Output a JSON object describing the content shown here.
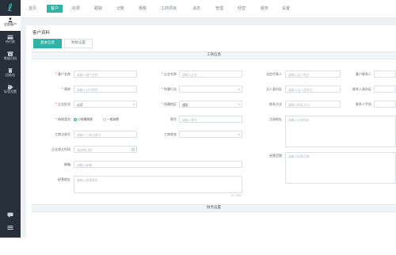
{
  "sidebar": {
    "items": [
      {
        "label": "全部客户",
        "icon": "user-icon"
      },
      {
        "label": "待付款",
        "icon": "card-icon"
      },
      {
        "label": "数据归档",
        "icon": "archive-icon"
      },
      {
        "label": "回收站",
        "icon": "trash-icon"
      },
      {
        "label": "标签设置",
        "icon": "tag-icon"
      }
    ]
  },
  "topnav": {
    "tabs": [
      "首页",
      "客户",
      "收费",
      "跟踪",
      "记账",
      "报税",
      "工商项目",
      "消息",
      "管理",
      "经营",
      "服务",
      "设置"
    ],
    "active_index": 1
  },
  "page": {
    "title": "客户资料",
    "tabs": [
      "基本信息",
      "财税设置"
    ],
    "active_tab": 0,
    "section_business": "工商信息",
    "section_finance": "财务设置"
  },
  "form": {
    "customer_name": {
      "label": "客户名称",
      "placeholder": "请输入客户名称"
    },
    "company_name": {
      "label": "企业名称",
      "placeholder": "请输入企业"
    },
    "short_name": {
      "label": "简称",
      "placeholder": "请输入公司简称"
    },
    "industry": {
      "label": "所属行业",
      "placeholder": ""
    },
    "company_form": {
      "label": "企业形式",
      "value": "公司"
    },
    "region": {
      "label": "所属地区",
      "value": "通用"
    },
    "tax_type": {
      "label": "纳税类别",
      "options": [
        "小规模纳税",
        "一般纳税"
      ],
      "selected": 0
    },
    "tax_id": {
      "label": "税号",
      "placeholder": "请输入税号"
    },
    "reg_no": {
      "label": "工商注册号",
      "placeholder": "请输入工商注册号"
    },
    "status": {
      "label": "工商状态",
      "placeholder": ""
    },
    "founded_date": {
      "label": "企业成立时间",
      "placeholder": "请选择日期"
    },
    "email": {
      "label": "邮箱",
      "placeholder": "请输入邮箱"
    },
    "op_address": {
      "label": "经营地址",
      "placeholder": "请输入经营地址"
    },
    "legal_rep": {
      "label": "法定代表人",
      "placeholder": "请输入法人姓名"
    },
    "legal_id": {
      "label": "法人身份证",
      "placeholder": "请输入法人身份证"
    },
    "contact": {
      "label": "联系方式",
      "placeholder": "请输入联系方式"
    },
    "reg_address": {
      "label": "注册地址",
      "placeholder": "请输入注册地址"
    },
    "scope": {
      "label": "经营范围",
      "placeholder": "请输入经营范围"
    },
    "customer_contact": {
      "label": "客户联系人",
      "placeholder": ""
    },
    "contact_id": {
      "label": "联系人身份证",
      "placeholder": ""
    },
    "contact_phone": {
      "label": "联系人手机",
      "placeholder": ""
    },
    "address_counter": "0 / 100"
  },
  "colors": {
    "accent": "#2fb3a6",
    "sidebar_bg": "#27303a",
    "required": "#e05454"
  }
}
